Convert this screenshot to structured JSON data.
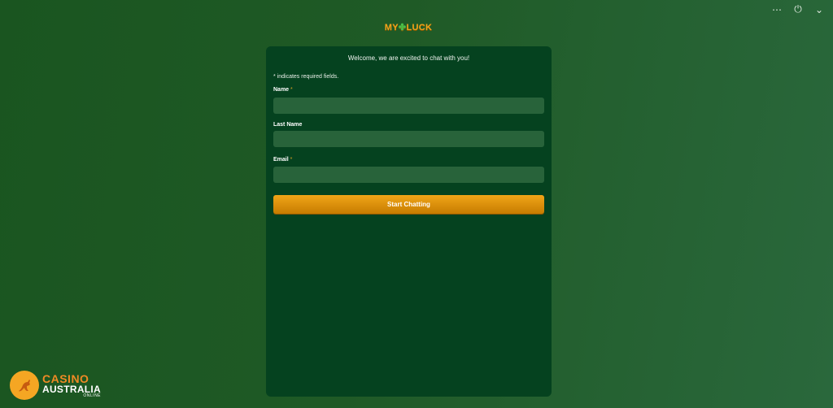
{
  "window_controls": {
    "more": "⋯",
    "power": "⏻",
    "collapse": "⌄"
  },
  "brand": {
    "left": "MY",
    "right": "LUCK"
  },
  "panel": {
    "welcome": "Welcome, we are excited to chat with you!",
    "required_note": "* indicates required fields.",
    "fields": [
      {
        "label": "Name",
        "required": "*",
        "value": ""
      },
      {
        "label": "Last Name",
        "value": ""
      },
      {
        "label": "Email",
        "required": "*",
        "value": ""
      }
    ],
    "submit_label": "Start Chatting"
  },
  "footer_logo": {
    "line1": "CASINO",
    "line2": "AUSTRALIA",
    "line3": "ONLINE"
  },
  "colors": {
    "accent": "#f0a518",
    "panel_bg": "#05421f",
    "input_bg": "#28633a"
  }
}
